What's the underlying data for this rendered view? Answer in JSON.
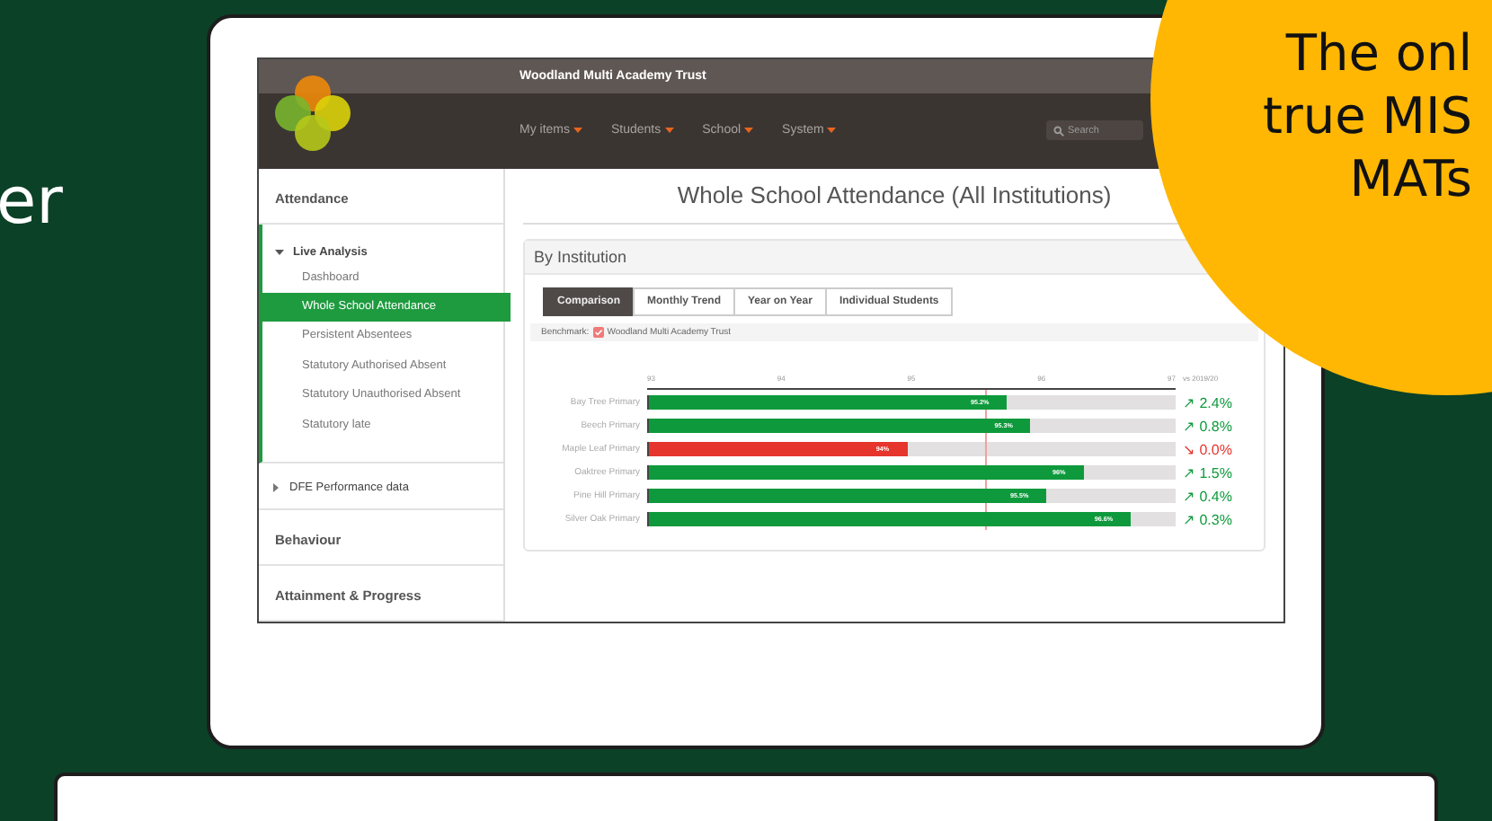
{
  "headline_fragment": "er",
  "callout": {
    "lines": [
      "The onl",
      "true MIS",
      "MATs"
    ]
  },
  "app": {
    "org_name": "Woodland Multi Academy Trust",
    "menu": [
      {
        "label": "My items"
      },
      {
        "label": "Students"
      },
      {
        "label": "School"
      },
      {
        "label": "System"
      }
    ],
    "search": {
      "placeholder": "Search"
    },
    "sidebar": [
      {
        "label": "Attendance",
        "children": [
          {
            "label": "Live Analysis",
            "expanded": true,
            "children": [
              {
                "label": "Dashboard",
                "selected": false
              },
              {
                "label": "Whole School Attendance",
                "selected": true
              },
              {
                "label": "Persistent Absentees",
                "selected": false
              },
              {
                "label": "Statutory Authorised Absent",
                "selected": false
              },
              {
                "label": "Statutory Unauthorised Absent",
                "selected": false
              },
              {
                "label": "Statutory late",
                "selected": false
              }
            ]
          },
          {
            "label": "DFE Performance data",
            "expanded": false
          }
        ]
      },
      {
        "label": "Behaviour"
      },
      {
        "label": "Attainment & Progress"
      }
    ],
    "page_title": "Whole School Attendance (All Institutions)",
    "panel": {
      "title": "By Institution",
      "tabs": [
        {
          "label": "Comparison",
          "selected": true
        },
        {
          "label": "Monthly Trend",
          "selected": false
        },
        {
          "label": "Year on Year",
          "selected": false
        },
        {
          "label": "Individual Students",
          "selected": false
        }
      ],
      "benchmark": {
        "label": "Benchmark:",
        "name": "Woodland Multi Academy Trust",
        "level": 0.64
      },
      "ticks": [
        "93",
        "94",
        "95",
        "96",
        "97"
      ],
      "change_header": "vs 2019/20",
      "rows": [
        {
          "name": "Bay Tree Primary",
          "level": 0.68,
          "value": "95.2%",
          "color": "#0e9a3c",
          "arrow": "↗",
          "change": "2.4%"
        },
        {
          "name": "Beech Primary",
          "level": 0.725,
          "value": "95.3%",
          "color": "#0e9a3c",
          "arrow": "↗",
          "change": "0.8%"
        },
        {
          "name": "Maple Leaf Primary",
          "level": 0.49,
          "value": "94%",
          "color": "#e5352d",
          "arrow": "↘",
          "change": "0.0%"
        },
        {
          "name": "Oaktree Primary",
          "level": 0.825,
          "value": "96%",
          "color": "#0e9a3c",
          "arrow": "↗",
          "change": "1.5%"
        },
        {
          "name": "Pine Hill Primary",
          "level": 0.755,
          "value": "95.5%",
          "color": "#0e9a3c",
          "arrow": "↗",
          "change": "0.4%"
        },
        {
          "name": "Silver Oak Primary",
          "level": 0.915,
          "value": "96.6%",
          "color": "#0e9a3c",
          "arrow": "↗",
          "change": "0.3%"
        }
      ]
    }
  }
}
